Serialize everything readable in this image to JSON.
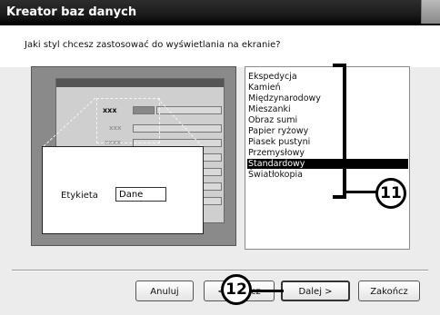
{
  "window": {
    "title": "Kreator baz danych"
  },
  "question": "Jaki styl chcesz zastosować do wyświetlania na ekranie?",
  "preview": {
    "field_label": "Etykieta",
    "field_value": "Dane",
    "placeholder_labels": [
      "xxx",
      "xxx",
      "xxxx"
    ]
  },
  "styles": {
    "items": [
      "Ekspedycja",
      "Kamień",
      "Międzynarodowy",
      "Mieszanki",
      "Obraz sumi",
      "Papier ryżowy",
      "Piasek pustyni",
      "Przemysłowy",
      "Standardowy",
      "Światłokopia"
    ],
    "selected": "Standardowy"
  },
  "buttons": {
    "cancel": "Anuluj",
    "back": "< Wstecz",
    "next": "Dalej >",
    "finish": "Zakończ"
  },
  "callouts": {
    "list": "11",
    "back_button": "12"
  }
}
